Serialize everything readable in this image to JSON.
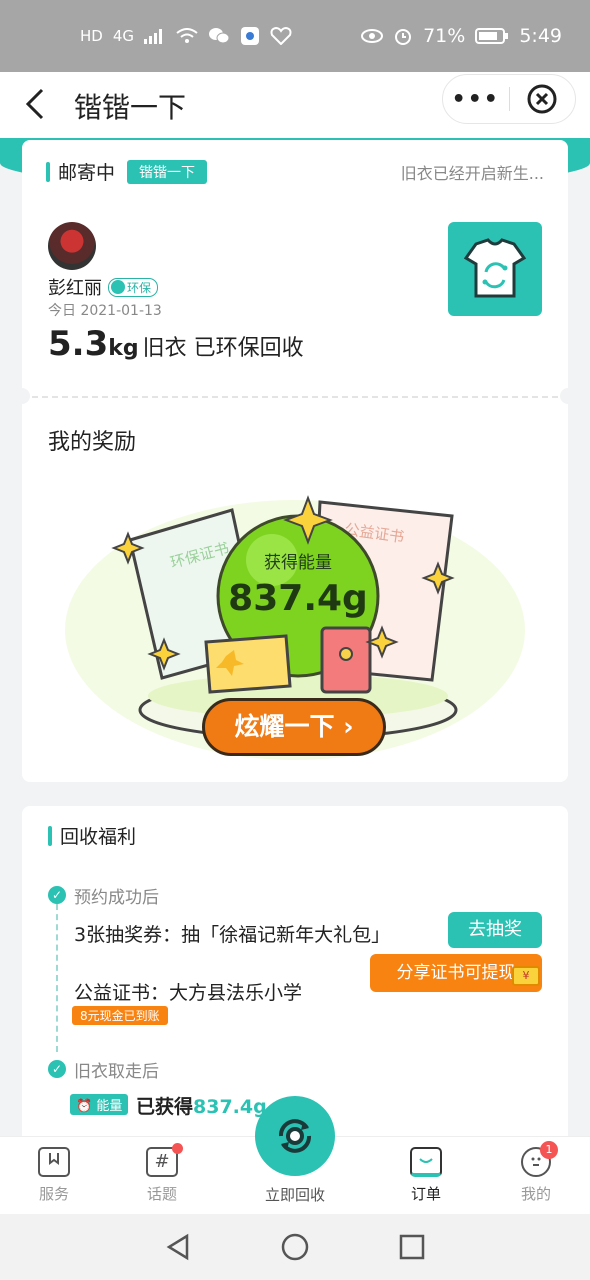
{
  "status_bar": {
    "left_icons": [
      "HD",
      "4G",
      "signal-icon",
      "wifi-icon",
      "wechat-icon",
      "app-icon",
      "health-icon"
    ],
    "battery": "71%",
    "time": "5:49"
  },
  "header": {
    "back_icon": "chevron-left-icon",
    "title": "锴锴一下",
    "more": "•••",
    "close_icon": "close-circle-icon"
  },
  "order_card": {
    "status": "邮寄中",
    "tag": "锴锴一下",
    "status_right": "旧衣已经开启新生...",
    "user_name": "彭红丽",
    "eco_badge": "环保",
    "date": "今日 2021-01-13",
    "weight_number": "5.3",
    "weight_unit": "kg",
    "weight_text": "旧衣 已环保回收",
    "shirt_icon": "recycle-shirt-icon"
  },
  "rewards": {
    "title": "我的奖励",
    "energy_label": "获得能量",
    "energy_value": "837.4g",
    "cert_left": "环保证书",
    "cert_right": "公益证书",
    "cta": "炫耀一下 ›",
    "colors": {
      "ball": "#7ed321",
      "cta": "#f07a14",
      "cta_border": "#3a2a1a"
    }
  },
  "welfare": {
    "title": "回收福利",
    "step1_label": "预约成功后",
    "lottery_text": "3张抽奖券：抽「徐福记新年大礼包」",
    "lottery_button": "去抽奖",
    "cert_text": "公益证书：大方县法乐小学",
    "cash_tag": "8元现金已到账",
    "share_button": "分享证书可提现",
    "step2_label": "旧衣取走后",
    "energy_tag": "能量",
    "earned_prefix": "已获得",
    "earned_value": "837.4g"
  },
  "tab_bar": {
    "tabs": [
      {
        "label": "服务",
        "icon": "bookmark-icon"
      },
      {
        "label": "话题",
        "icon": "hash-icon"
      },
      {
        "label": "立即回收",
        "icon": "recycle-icon"
      },
      {
        "label": "订单",
        "icon": "order-icon"
      },
      {
        "label": "我的",
        "icon": "face-icon"
      }
    ],
    "my_badge": "1"
  },
  "colors": {
    "accent": "#2bc1b3",
    "orange": "#f88311"
  }
}
